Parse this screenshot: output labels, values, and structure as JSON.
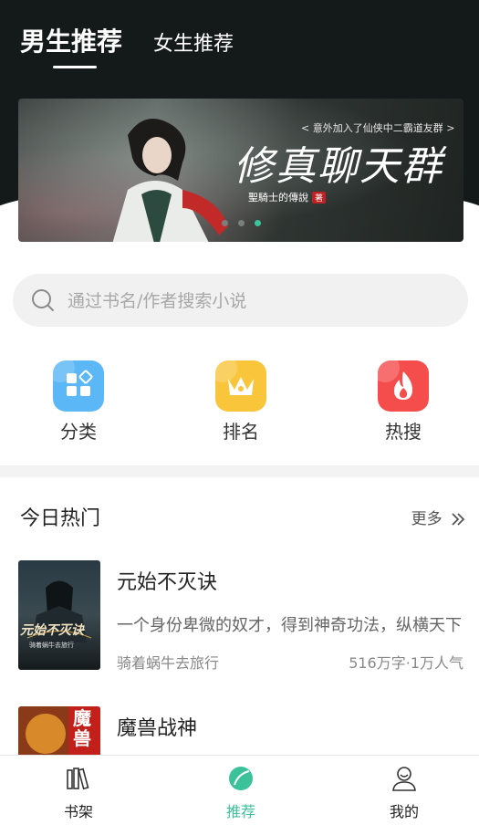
{
  "header": {
    "tabs": [
      {
        "label": "男生推荐",
        "active": true
      },
      {
        "label": "女生推荐",
        "active": false
      }
    ]
  },
  "banner": {
    "subtitle": "< 意外加入了仙侠中二霸道友群 >",
    "title": "修真聊天群",
    "author": "聖騎士的傳說",
    "author_tag": "著",
    "page_count": 3,
    "active_page": 3
  },
  "search": {
    "placeholder": "通过书名/作者搜索小说",
    "value": ""
  },
  "quick_links": [
    {
      "label": "分类",
      "icon": "category-icon",
      "color": "#5bb7f5"
    },
    {
      "label": "排名",
      "icon": "crown-icon",
      "color": "#f8c53b"
    },
    {
      "label": "热搜",
      "icon": "flame-icon",
      "color": "#f54c4c"
    }
  ],
  "hot": {
    "title": "今日热门",
    "more_label": "更多",
    "books": [
      {
        "title": "元始不灭诀",
        "description": "一个身份卑微的奴才，得到神奇功法，纵横天下",
        "author": "骑着蜗牛去旅行",
        "stats": "516万字·1万人气",
        "cover_text": "元始不灭诀",
        "cover_author": "骑着蜗牛去旅行"
      },
      {
        "title": "魔兽战神",
        "description": "",
        "author": "",
        "stats": "",
        "cover_text": "魔兽"
      }
    ]
  },
  "bottom_nav": [
    {
      "label": "书架",
      "icon": "bookshelf-icon",
      "active": false
    },
    {
      "label": "推荐",
      "icon": "recommend-icon",
      "active": true
    },
    {
      "label": "我的",
      "icon": "profile-icon",
      "active": false
    }
  ],
  "colors": {
    "accent": "#3cc29a",
    "header_bg": "#141a1a"
  }
}
